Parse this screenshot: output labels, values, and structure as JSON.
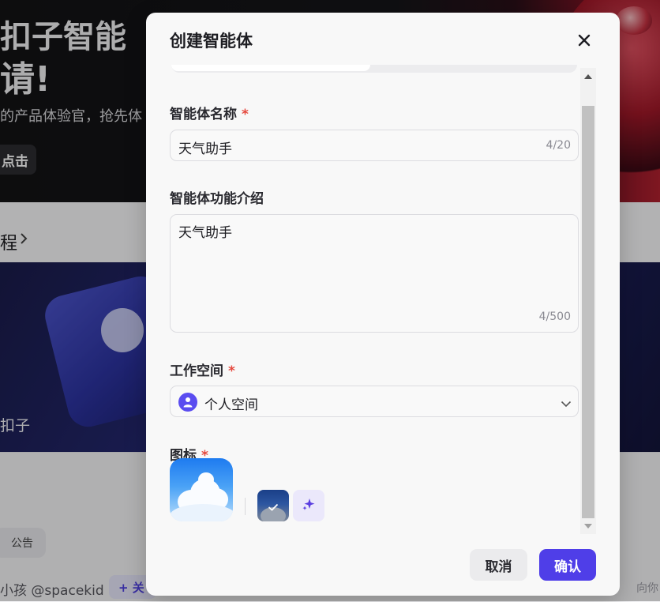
{
  "background": {
    "hero_line1": "扣子智能",
    "hero_line2": "请!",
    "hero_sub": "的产品体验官，抢先体",
    "hero_button": "点击",
    "section_title": "程",
    "banner_label": "扣子",
    "notice_chip": "公告",
    "author": "小孩 @spacekid",
    "follow_button": "+ 关",
    "right_hint": "向你"
  },
  "dialog": {
    "title": "创建智能体",
    "name": {
      "label": "智能体名称",
      "required_mark": "*",
      "value": "天气助手",
      "counter": "4/20"
    },
    "description": {
      "label": "智能体功能介绍",
      "value": "天气助手",
      "counter": "4/500"
    },
    "workspace": {
      "label": "工作空间",
      "required_mark": "*",
      "selected": "个人空间"
    },
    "icon": {
      "label": "图标",
      "required_mark": "*"
    },
    "cancel_label": "取消",
    "confirm_label": "确认"
  },
  "colors": {
    "accent": "#4f3ee8",
    "required": "#e5483d"
  }
}
